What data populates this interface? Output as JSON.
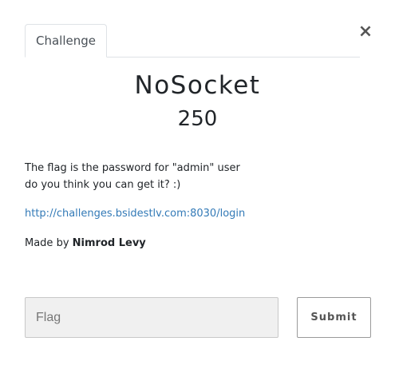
{
  "modal": {
    "close_label": "×"
  },
  "tabs": [
    {
      "label": "Challenge"
    }
  ],
  "challenge": {
    "name": "NoSocket",
    "value": "250",
    "description_lines": [
      "The flag is the password for \"admin\" user",
      "do you think you can get it? :)"
    ],
    "link_text": "http://challenges.bsidestlv.com:8030/login",
    "author_prefix": "Made by ",
    "author_name": "Nimrod Levy"
  },
  "form": {
    "flag_placeholder": "Flag",
    "flag_value": "",
    "submit_label": "Submit"
  },
  "icons": {
    "close": "close-icon"
  },
  "colors": {
    "link": "#337ab7",
    "input_bg": "#f0f0f0"
  }
}
